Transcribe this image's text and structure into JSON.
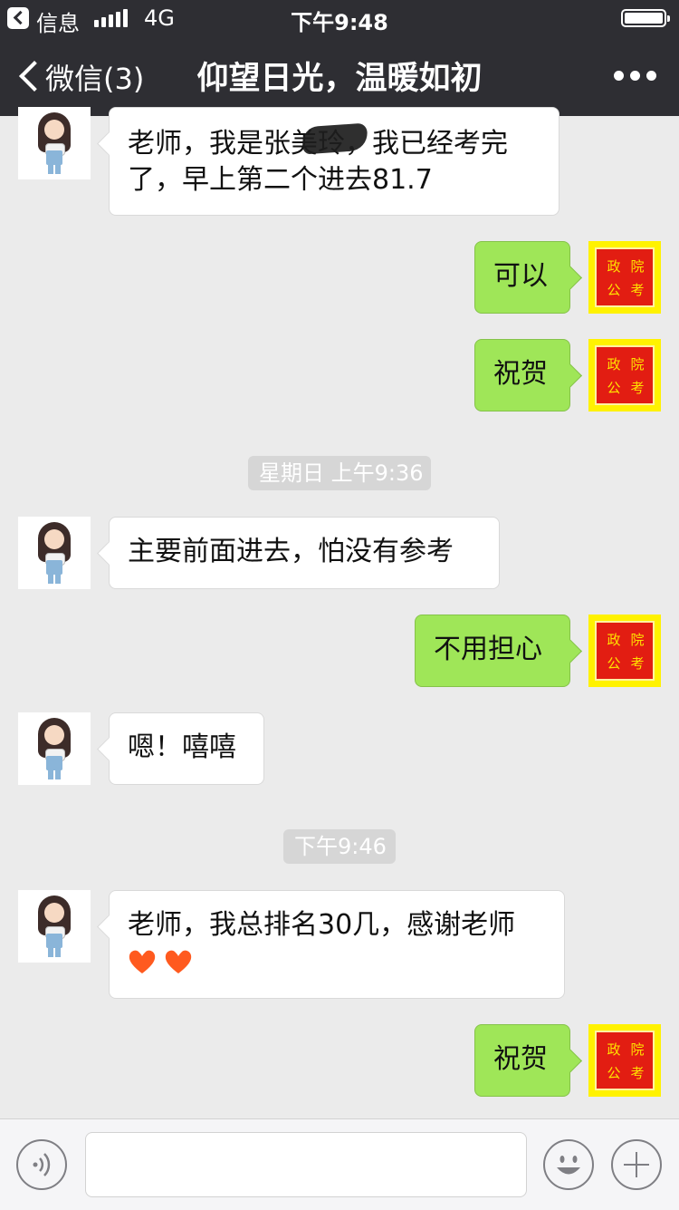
{
  "status_bar": {
    "app": "信息",
    "network": "4G",
    "time": "下午9:48"
  },
  "nav": {
    "back_label": "微信(3)",
    "title": "仰望日光，温暖如初"
  },
  "seal_chars": [
    "政",
    "院",
    "公",
    "考"
  ],
  "timestamps": {
    "sunday": "星期日 上午9:36",
    "evening": "下午9:46"
  },
  "messages": [
    {
      "side": "left",
      "text": "老师，我是张美玲，我已经考完了，早上第二个进去81.7"
    },
    {
      "side": "right",
      "text": "可以"
    },
    {
      "side": "right",
      "text": "祝贺"
    },
    {
      "side": "left",
      "text": "主要前面进去，怕没有参考"
    },
    {
      "side": "right",
      "text": "不用担心"
    },
    {
      "side": "left",
      "text": "嗯！嘻嘻"
    },
    {
      "side": "left",
      "text": "老师，我总排名30几，感谢老师"
    },
    {
      "side": "right",
      "text": "祝贺"
    }
  ],
  "colors": {
    "nav_bg": "#2e2e33",
    "chat_bg": "#ebebeb",
    "sent_bubble": "#9fe658",
    "received_bubble": "#ffffff",
    "seal_red": "#e21d12",
    "seal_yellow": "#fff200",
    "heart": "#ff5a1f"
  }
}
